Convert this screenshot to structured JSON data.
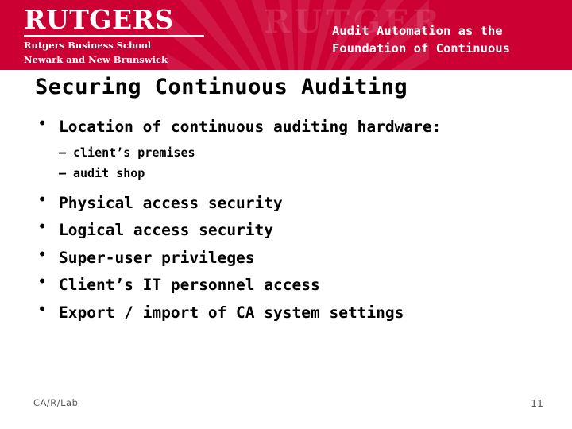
{
  "header": {
    "logo_word": "RUTGERS",
    "logo_sub_line1": "Rutgers Business School",
    "logo_sub_line2": "Newark and New Brunswick",
    "ghost_text": "RUTGER",
    "title_line1": "Audit Automation as the",
    "title_line2": "Foundation of Continuous",
    "band_color": "#cc0033"
  },
  "slide": {
    "title": "Securing Continuous Auditing",
    "bullets": [
      {
        "level": 1,
        "text": "Location of continuous auditing hardware:"
      },
      {
        "level": 2,
        "text": "client’s premises"
      },
      {
        "level": 2,
        "text": "audit shop"
      },
      {
        "level": 1,
        "text": "Physical access security"
      },
      {
        "level": 1,
        "text": "Logical access security"
      },
      {
        "level": 1,
        "text": "Super-user privileges"
      },
      {
        "level": 1,
        "text": "Client’s IT personnel access"
      },
      {
        "level": 1,
        "text": "Export / import of CA system settings"
      }
    ]
  },
  "footer": {
    "label": "CA/R/Lab",
    "page_number": "11"
  }
}
